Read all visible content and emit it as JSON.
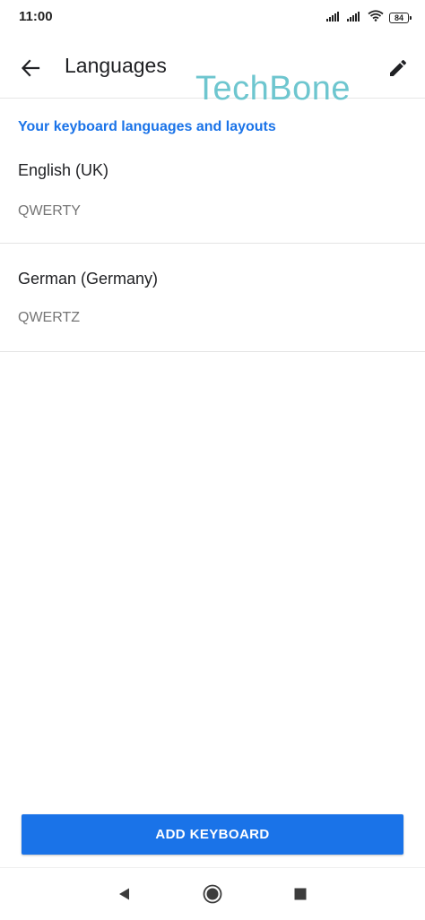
{
  "status_bar": {
    "time": "11:00",
    "battery": "84",
    "icons": [
      "signal-icon",
      "signal-icon",
      "wifi-icon",
      "battery-icon"
    ]
  },
  "app_bar": {
    "title": "Languages",
    "back_icon": "arrow-left-icon",
    "edit_icon": "pencil-icon"
  },
  "watermark": "TechBone",
  "section": {
    "header": "Your keyboard languages and layouts"
  },
  "languages": [
    {
      "name": "English (UK)",
      "layout": "QWERTY"
    },
    {
      "name": "German (Germany)",
      "layout": "QWERTZ"
    }
  ],
  "add_button": {
    "label": "ADD KEYBOARD"
  },
  "nav_bar": {
    "icons": [
      "triangle-back-icon",
      "circle-home-icon",
      "square-recents-icon"
    ]
  },
  "colors": {
    "accent": "#1a73e8",
    "watermark": "#6ec6cf",
    "secondary_text": "#757575"
  }
}
